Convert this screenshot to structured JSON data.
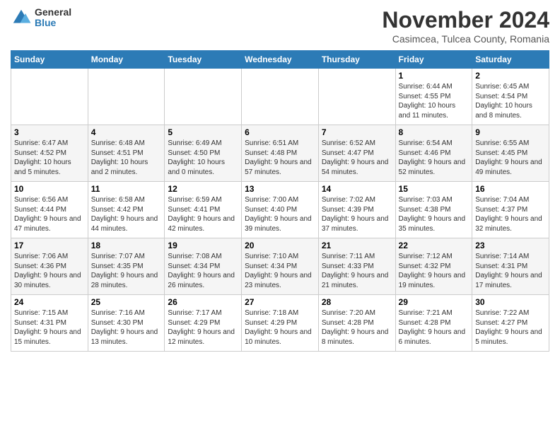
{
  "header": {
    "logo_general": "General",
    "logo_blue": "Blue",
    "month_title": "November 2024",
    "location": "Casimcea, Tulcea County, Romania"
  },
  "calendar": {
    "headers": [
      "Sunday",
      "Monday",
      "Tuesday",
      "Wednesday",
      "Thursday",
      "Friday",
      "Saturday"
    ],
    "weeks": [
      [
        {
          "day": "",
          "info": ""
        },
        {
          "day": "",
          "info": ""
        },
        {
          "day": "",
          "info": ""
        },
        {
          "day": "",
          "info": ""
        },
        {
          "day": "",
          "info": ""
        },
        {
          "day": "1",
          "info": "Sunrise: 6:44 AM\nSunset: 4:55 PM\nDaylight: 10 hours and 11 minutes."
        },
        {
          "day": "2",
          "info": "Sunrise: 6:45 AM\nSunset: 4:54 PM\nDaylight: 10 hours and 8 minutes."
        }
      ],
      [
        {
          "day": "3",
          "info": "Sunrise: 6:47 AM\nSunset: 4:52 PM\nDaylight: 10 hours and 5 minutes."
        },
        {
          "day": "4",
          "info": "Sunrise: 6:48 AM\nSunset: 4:51 PM\nDaylight: 10 hours and 2 minutes."
        },
        {
          "day": "5",
          "info": "Sunrise: 6:49 AM\nSunset: 4:50 PM\nDaylight: 10 hours and 0 minutes."
        },
        {
          "day": "6",
          "info": "Sunrise: 6:51 AM\nSunset: 4:48 PM\nDaylight: 9 hours and 57 minutes."
        },
        {
          "day": "7",
          "info": "Sunrise: 6:52 AM\nSunset: 4:47 PM\nDaylight: 9 hours and 54 minutes."
        },
        {
          "day": "8",
          "info": "Sunrise: 6:54 AM\nSunset: 4:46 PM\nDaylight: 9 hours and 52 minutes."
        },
        {
          "day": "9",
          "info": "Sunrise: 6:55 AM\nSunset: 4:45 PM\nDaylight: 9 hours and 49 minutes."
        }
      ],
      [
        {
          "day": "10",
          "info": "Sunrise: 6:56 AM\nSunset: 4:44 PM\nDaylight: 9 hours and 47 minutes."
        },
        {
          "day": "11",
          "info": "Sunrise: 6:58 AM\nSunset: 4:42 PM\nDaylight: 9 hours and 44 minutes."
        },
        {
          "day": "12",
          "info": "Sunrise: 6:59 AM\nSunset: 4:41 PM\nDaylight: 9 hours and 42 minutes."
        },
        {
          "day": "13",
          "info": "Sunrise: 7:00 AM\nSunset: 4:40 PM\nDaylight: 9 hours and 39 minutes."
        },
        {
          "day": "14",
          "info": "Sunrise: 7:02 AM\nSunset: 4:39 PM\nDaylight: 9 hours and 37 minutes."
        },
        {
          "day": "15",
          "info": "Sunrise: 7:03 AM\nSunset: 4:38 PM\nDaylight: 9 hours and 35 minutes."
        },
        {
          "day": "16",
          "info": "Sunrise: 7:04 AM\nSunset: 4:37 PM\nDaylight: 9 hours and 32 minutes."
        }
      ],
      [
        {
          "day": "17",
          "info": "Sunrise: 7:06 AM\nSunset: 4:36 PM\nDaylight: 9 hours and 30 minutes."
        },
        {
          "day": "18",
          "info": "Sunrise: 7:07 AM\nSunset: 4:35 PM\nDaylight: 9 hours and 28 minutes."
        },
        {
          "day": "19",
          "info": "Sunrise: 7:08 AM\nSunset: 4:34 PM\nDaylight: 9 hours and 26 minutes."
        },
        {
          "day": "20",
          "info": "Sunrise: 7:10 AM\nSunset: 4:34 PM\nDaylight: 9 hours and 23 minutes."
        },
        {
          "day": "21",
          "info": "Sunrise: 7:11 AM\nSunset: 4:33 PM\nDaylight: 9 hours and 21 minutes."
        },
        {
          "day": "22",
          "info": "Sunrise: 7:12 AM\nSunset: 4:32 PM\nDaylight: 9 hours and 19 minutes."
        },
        {
          "day": "23",
          "info": "Sunrise: 7:14 AM\nSunset: 4:31 PM\nDaylight: 9 hours and 17 minutes."
        }
      ],
      [
        {
          "day": "24",
          "info": "Sunrise: 7:15 AM\nSunset: 4:31 PM\nDaylight: 9 hours and 15 minutes."
        },
        {
          "day": "25",
          "info": "Sunrise: 7:16 AM\nSunset: 4:30 PM\nDaylight: 9 hours and 13 minutes."
        },
        {
          "day": "26",
          "info": "Sunrise: 7:17 AM\nSunset: 4:29 PM\nDaylight: 9 hours and 12 minutes."
        },
        {
          "day": "27",
          "info": "Sunrise: 7:18 AM\nSunset: 4:29 PM\nDaylight: 9 hours and 10 minutes."
        },
        {
          "day": "28",
          "info": "Sunrise: 7:20 AM\nSunset: 4:28 PM\nDaylight: 9 hours and 8 minutes."
        },
        {
          "day": "29",
          "info": "Sunrise: 7:21 AM\nSunset: 4:28 PM\nDaylight: 9 hours and 6 minutes."
        },
        {
          "day": "30",
          "info": "Sunrise: 7:22 AM\nSunset: 4:27 PM\nDaylight: 9 hours and 5 minutes."
        }
      ]
    ]
  }
}
